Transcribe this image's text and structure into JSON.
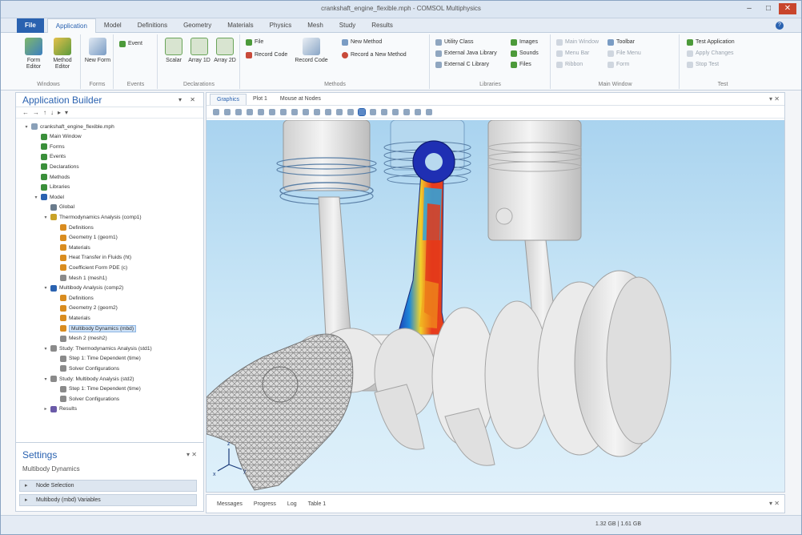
{
  "window": {
    "title": "crankshaft_engine_flexible.mph - COMSOL Multiphysics",
    "controls": [
      "–",
      "□",
      "✕"
    ]
  },
  "menu": {
    "file": "File",
    "tabs": [
      "Application",
      "Model",
      "Definitions",
      "Geometry",
      "Materials",
      "Physics",
      "Mesh",
      "Study",
      "Results"
    ],
    "active_index": 0,
    "help": "?"
  },
  "ribbon": {
    "groups": [
      {
        "label": "Windows",
        "buttons": [
          "Form Editor",
          "Method Editor"
        ]
      },
      {
        "label": "Forms",
        "buttons": [
          "New Form"
        ]
      },
      {
        "label": "Events",
        "buttons": [
          "Event"
        ]
      },
      {
        "label": "Declarations",
        "buttons": [
          "Scalar",
          "Array 1D",
          "Array 2D"
        ]
      },
      {
        "label": "Methods",
        "buttons": [
          "Record Code"
        ],
        "small": [
          "New Method",
          "Record a New Method"
        ]
      }
    ],
    "small_groups": [
      {
        "label": "Libraries",
        "items": [
          "Utility Class",
          "External Java Library",
          "External C Library"
        ]
      },
      {
        "label": "",
        "items": [
          "Images",
          "Sounds",
          "Files"
        ]
      },
      {
        "label": "Main Window",
        "items": [
          "Main Window",
          "Menu Bar",
          "Ribbon",
          "Toolbar",
          "File Menu",
          "Form"
        ]
      },
      {
        "label": "Test",
        "items": [
          "Test Application",
          "Apply Changes",
          "Stop Test"
        ]
      }
    ],
    "misc": [
      "File",
      "Record Code"
    ]
  },
  "app_builder": {
    "title": "Application Builder",
    "tree": [
      {
        "level": 0,
        "label": "crankshaft_engine_flexible.mph",
        "twist": "▾",
        "icon": "#8aa0b8"
      },
      {
        "level": 1,
        "label": "Main Window",
        "twist": "",
        "icon": "#3a8f3a"
      },
      {
        "level": 1,
        "label": "Forms",
        "twist": "",
        "icon": "#3a8f3a"
      },
      {
        "level": 1,
        "label": "Events",
        "twist": "",
        "icon": "#3a8f3a"
      },
      {
        "level": 1,
        "label": "Declarations",
        "twist": "",
        "icon": "#3a8f3a"
      },
      {
        "level": 1,
        "label": "Methods",
        "twist": "",
        "icon": "#3a8f3a"
      },
      {
        "level": 1,
        "label": "Libraries",
        "twist": "",
        "icon": "#3a8f3a"
      },
      {
        "level": 1,
        "label": "Model",
        "twist": "▾",
        "icon": "#2a62b0"
      },
      {
        "level": 2,
        "label": "Global",
        "twist": "",
        "icon": "#6a7b8c"
      },
      {
        "level": 2,
        "label": "Thermodynamics Analysis (comp1)",
        "twist": "▾",
        "icon": "#c9a227"
      },
      {
        "level": 3,
        "label": "Definitions",
        "twist": "",
        "icon": "#d98c1f"
      },
      {
        "level": 3,
        "label": "Geometry 1 (geom1)",
        "twist": "",
        "icon": "#d98c1f"
      },
      {
        "level": 3,
        "label": "Materials",
        "twist": "",
        "icon": "#d98c1f"
      },
      {
        "level": 3,
        "label": "Heat Transfer in Fluids (ht)",
        "twist": "",
        "icon": "#d98c1f"
      },
      {
        "level": 3,
        "label": "Coefficient Form PDE (c)",
        "twist": "",
        "icon": "#d98c1f"
      },
      {
        "level": 3,
        "label": "Mesh 1 (mesh1)",
        "twist": "",
        "icon": "#8a8a8a"
      },
      {
        "level": 2,
        "label": "Multibody Analysis (comp2)",
        "twist": "▾",
        "icon": "#2a62b0"
      },
      {
        "level": 3,
        "label": "Definitions",
        "twist": "",
        "icon": "#d98c1f"
      },
      {
        "level": 3,
        "label": "Geometry 2 (geom2)",
        "twist": "",
        "icon": "#d98c1f"
      },
      {
        "level": 3,
        "label": "Materials",
        "twist": "",
        "icon": "#d98c1f"
      },
      {
        "level": 3,
        "label": "Multibody Dynamics (mbd)",
        "twist": "",
        "icon": "#d98c1f",
        "selected": true
      },
      {
        "level": 3,
        "label": "Mesh 2 (mesh2)",
        "twist": "",
        "icon": "#8a8a8a"
      },
      {
        "level": 2,
        "label": "Study: Thermodynamics Analysis (std1)",
        "twist": "▾",
        "icon": "#8a8a8a"
      },
      {
        "level": 3,
        "label": "Step 1: Time Dependent (time)",
        "twist": "",
        "icon": "#8a8a8a"
      },
      {
        "level": 3,
        "label": "Solver Configurations",
        "twist": "",
        "icon": "#8a8a8a"
      },
      {
        "level": 2,
        "label": "Study: Multibody Analysis (std2)",
        "twist": "▾",
        "icon": "#8a8a8a"
      },
      {
        "level": 3,
        "label": "Step 1: Time Dependent (time)",
        "twist": "",
        "icon": "#8a8a8a"
      },
      {
        "level": 3,
        "label": "Solver Configurations",
        "twist": "",
        "icon": "#8a8a8a"
      },
      {
        "level": 2,
        "label": "Results",
        "twist": "▸",
        "icon": "#6a5aa8"
      }
    ]
  },
  "settings": {
    "title": "Settings",
    "subtitle": "Multibody Dynamics",
    "rows": [
      "Node Selection",
      "Multibody (mbd) Variables"
    ]
  },
  "graphics": {
    "tabs": [
      "Graphics",
      "Plot 1",
      "Mouse at Nodes"
    ],
    "active_index": 0
  },
  "bottom_panel": {
    "tabs": [
      "Messages",
      "Progress",
      "Log",
      "Table 1"
    ]
  },
  "status": {
    "memory": "1.32 GB | 1.61 GB"
  },
  "colors": {
    "accent": "#2a62b0",
    "sky_top": "#a9d3ef",
    "sky_bottom": "#dff0fa",
    "part_gray": "#e6e6e6"
  }
}
